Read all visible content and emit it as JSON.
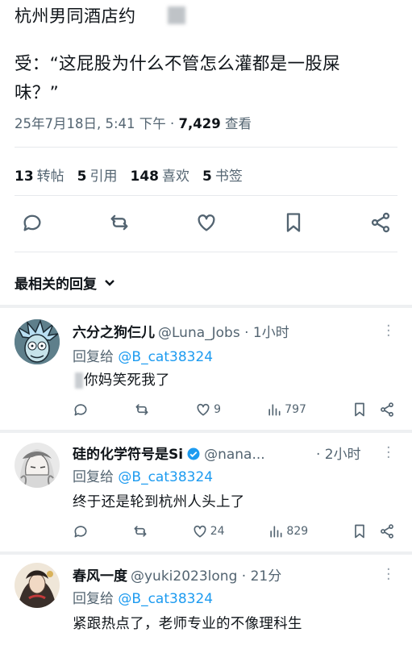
{
  "post": {
    "title": "杭州男同酒店约",
    "text_line1": "受：“这屁股为什么不管怎么灌都是一股屎",
    "text_line2": "味？”",
    "meta_date": "25年7月18日, 5:41 下午 · ",
    "meta_views_count": "7,429",
    "meta_views_label": " 查看"
  },
  "stats": [
    {
      "count": "13",
      "label": "转帖"
    },
    {
      "count": "5",
      "label": "引用"
    },
    {
      "count": "148",
      "label": "喜欢"
    },
    {
      "count": "5",
      "label": "书签"
    }
  ],
  "actions": [
    "reply-icon",
    "repost-icon",
    "like-icon",
    "bookmark-icon",
    "share-icon"
  ],
  "sort_label": "最相关的回复",
  "replies": [
    {
      "name": "六分之狗仨儿",
      "handle": "@Luna_Jobs · 1小时",
      "reply_prefix": "回复给 ",
      "reply_to": "@B_cat38324",
      "text": "你妈笑死我了",
      "likes": "9",
      "views": "797",
      "reposts": ""
    },
    {
      "name": "硅的化学符号是Si",
      "handle": "@nana...",
      "time": "· 2小时",
      "reply_prefix": "回复给 ",
      "reply_to": "@B_cat38324",
      "text": "终于还是轮到杭州人头上了",
      "likes": "24",
      "views": "829",
      "reposts": ""
    },
    {
      "name": "春风一度",
      "handle": "@yuki2023long · 21分",
      "reply_prefix": "回复给 ",
      "reply_to": "@B_cat38324",
      "text": "紧跟热点了，老师专业的不像理科生"
    }
  ],
  "colors": {
    "accent": "#1d9bf0",
    "muted": "#536471",
    "text": "#0f1419"
  }
}
